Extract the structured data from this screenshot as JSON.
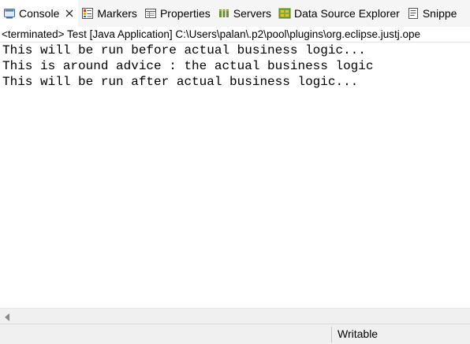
{
  "tabs": [
    {
      "label": "Console",
      "icon": "console-icon",
      "active": true,
      "closable": true
    },
    {
      "label": "Markers",
      "icon": "markers-icon"
    },
    {
      "label": "Properties",
      "icon": "properties-icon"
    },
    {
      "label": "Servers",
      "icon": "servers-icon"
    },
    {
      "label": "Data Source Explorer",
      "icon": "data-source-explorer-icon"
    },
    {
      "label": "Snippe",
      "icon": "snippets-icon"
    }
  ],
  "process_line": "<terminated> Test [Java Application] C:\\Users\\palan\\.p2\\pool\\plugins\\org.eclipse.justj.ope",
  "console_lines": [
    "This will be run before actual business logic...",
    "This is around advice : the actual business logic",
    "This will be run after actual business logic..."
  ],
  "status": {
    "writable": "Writable"
  },
  "colors": {
    "tabbar_bg": "#f5f5f5",
    "console_bg": "#ffffff",
    "statusbar_bg": "#f0f0f0"
  }
}
